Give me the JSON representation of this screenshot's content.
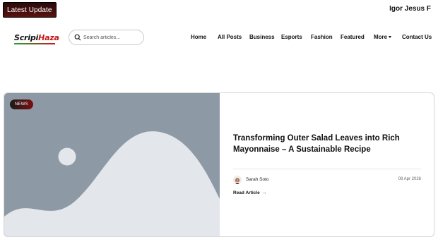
{
  "topbar": {
    "latest_label": "Latest Update",
    "user_name": "Igor Jesus F"
  },
  "header": {
    "logo": {
      "part1": "Scripi",
      "part2": "Haza",
      "part3": ""
    },
    "search": {
      "placeholder": "Search articles...",
      "value": ""
    },
    "nav": [
      {
        "label": "Home"
      },
      {
        "label": "All Posts"
      },
      {
        "label": "Business"
      },
      {
        "label": "Esports"
      },
      {
        "label": "Fashion"
      },
      {
        "label": "Featured"
      },
      {
        "label": "More"
      },
      {
        "label": "Contact Us"
      }
    ]
  },
  "featured": {
    "badge": "NEWS",
    "title": "Transforming Outer Salad Leaves into Rich Mayonnaise – A Sustainable Recipe",
    "author": "Sarah Soto",
    "date": "08 Apr 2026",
    "read_more": "Read Article",
    "image_icon": "image-placeholder-icon"
  },
  "colors": {
    "accent": "#7a1010",
    "placeholder_bg": "#8e99a6",
    "placeholder_shape": "#e3e6ea"
  }
}
